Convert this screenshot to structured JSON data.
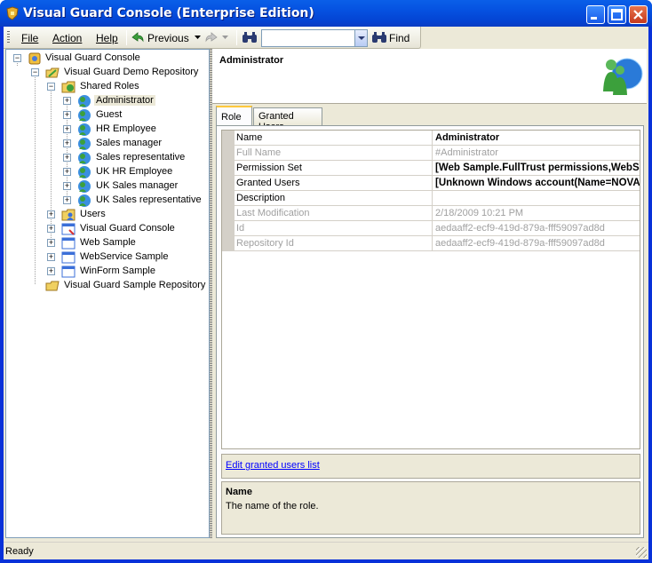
{
  "window": {
    "title": "Visual Guard Console  (Enterprise Edition)"
  },
  "toolbar": {
    "file": "File",
    "action": "Action",
    "help": "Help",
    "previous": "Previous",
    "find": "Find",
    "search_value": ""
  },
  "tree": {
    "items": [
      {
        "label": "Visual Guard Console",
        "icon": "console-icon"
      },
      {
        "label": "Visual Guard Demo Repository",
        "icon": "repository-icon"
      },
      {
        "label": "Shared Roles",
        "icon": "roles-folder-icon"
      },
      {
        "label": "Administrator",
        "icon": "role-icon"
      },
      {
        "label": "Guest",
        "icon": "role-icon"
      },
      {
        "label": "HR Employee",
        "icon": "role-icon"
      },
      {
        "label": "Sales manager",
        "icon": "role-icon"
      },
      {
        "label": "Sales representative",
        "icon": "role-icon"
      },
      {
        "label": "UK HR Employee",
        "icon": "role-icon"
      },
      {
        "label": "UK Sales manager",
        "icon": "role-icon"
      },
      {
        "label": "UK Sales representative",
        "icon": "role-icon"
      },
      {
        "label": "Users",
        "icon": "users-folder-icon"
      },
      {
        "label": "Visual Guard Console",
        "icon": "application-icon"
      },
      {
        "label": "Web Sample",
        "icon": "application-icon"
      },
      {
        "label": "WebService Sample",
        "icon": "application-icon"
      },
      {
        "label": "WinForm Sample",
        "icon": "application-icon"
      },
      {
        "label": "Visual Guard Sample Repository",
        "icon": "repository-icon"
      }
    ]
  },
  "detail": {
    "header_title": "Administrator",
    "tabs": [
      "Role",
      "Granted Users"
    ],
    "properties": [
      {
        "name": "Name",
        "value": "Administrator"
      },
      {
        "name": "Full Name",
        "value": "#Administrator"
      },
      {
        "name": "Permission Set",
        "value": "[Web Sample.FullTrust permissions,WebSe"
      },
      {
        "name": "Granted Users",
        "value": "[Unknown Windows account(Name=NOVAL"
      },
      {
        "name": "Description",
        "value": ""
      },
      {
        "name": "Last Modification",
        "value": "2/18/2009 10:21 PM"
      },
      {
        "name": "Id",
        "value": "aedaaff2-ecf9-419d-879a-fff59097ad8d"
      },
      {
        "name": "Repository Id",
        "value": "aedaaff2-ecf9-419d-879a-fff59097ad8d"
      }
    ],
    "link": "Edit granted users list",
    "desc_title": "Name",
    "desc_text": "The name of the role."
  },
  "status": {
    "text": "Ready"
  },
  "colors": {
    "titlebar": "#0551e0",
    "chrome": "#ece9d8",
    "link": "#0000ff"
  }
}
